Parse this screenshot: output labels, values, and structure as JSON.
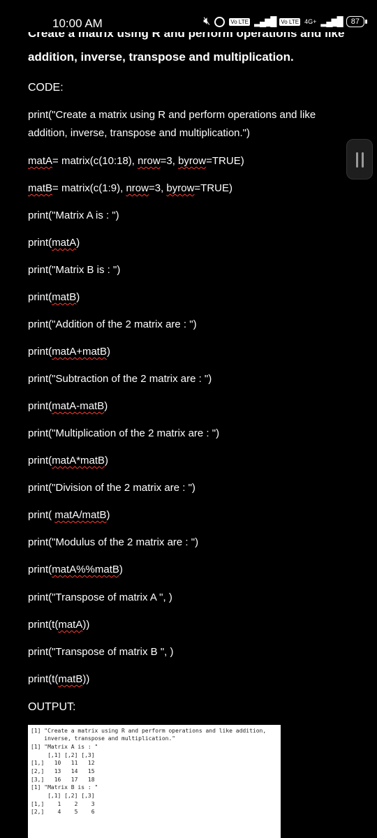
{
  "status_bar": {
    "time": "10:00 AM",
    "volte1": "Vo LTE",
    "volte2": "Vo LTE",
    "network": "4G+",
    "battery": "87",
    "icons": [
      "mute-icon",
      "alarm-icon",
      "signal-icon",
      "battery-icon"
    ]
  },
  "header": {
    "cut_title": "Create a matrix using R and perform operations and like",
    "title_line2": "addition, inverse, transpose and multiplication."
  },
  "labels": {
    "code": "CODE:",
    "output": "OUTPUT:"
  },
  "code": {
    "l0a": "print(\"Create a matrix using R and perform operations and like",
    "l0b": "addition, inverse, transpose and multiplication.\")",
    "l1a": "matA",
    "l1b": "= matrix(c(10:18), ",
    "l1c": "nrow",
    "l1d": "=3, ",
    "l1e": "byrow",
    "l1f": "=TRUE)",
    "l2a": "matB",
    "l2b": "= matrix(c(1:9), ",
    "l2c": "nrow",
    "l2d": "=3, ",
    "l2e": "byrow",
    "l2f": "=TRUE)",
    "l3": "print(\"Matrix A is : \")",
    "l4a": "print(",
    "l4b": "matA",
    "l4c": ")",
    "l5": "print(\"Matrix B is : \")",
    "l6a": "print(",
    "l6b": "matB",
    "l6c": ")",
    "l7": "print(\"Addition of the 2 matrix are : \")",
    "l8a": "print(",
    "l8b": "matA+matB",
    "l8c": ")",
    "l9": "print(\"Subtraction of the 2 matrix are : \")",
    "l10a": "print(",
    "l10b": "matA-matB",
    "l10c": ")",
    "l11": "print(\"Multiplication of the 2 matrix are : \")",
    "l12a": "print(",
    "l12b": "matA*matB",
    "l12c": ")",
    "l13": "print(\"Division of the 2 matrix are : \")",
    "l14a": "print( ",
    "l14b": "matA/matB",
    "l14c": ")",
    "l15": "print(\"Modulus of the 2 matrix are : \")",
    "l16a": "print(",
    "l16b": "matA%%matB",
    "l16c": ")",
    "l17": "print(\"Transpose of matrix A \", )",
    "l18a": "print(t(",
    "l18b": "matA",
    "l18c": "))",
    "l19": "print(\"Transpose of matrix B \", )",
    "l20a": "print(t(",
    "l20b": "matB",
    "l20c": "))"
  },
  "console": {
    "lines": [
      "[1] \"Create a matrix using R and perform operations and like addition,",
      "    inverse, transpose and multiplication.\"",
      "[1] \"Matrix A is : \"",
      "     [,1] [,2] [,3]",
      "[1,]   10   11   12",
      "[2,]   13   14   15",
      "[3,]   16   17   18",
      "[1] \"Matrix B is : \"",
      "     [,1] [,2] [,3]",
      "[1,]    1    2    3",
      "[2,]    4    5    6"
    ]
  }
}
